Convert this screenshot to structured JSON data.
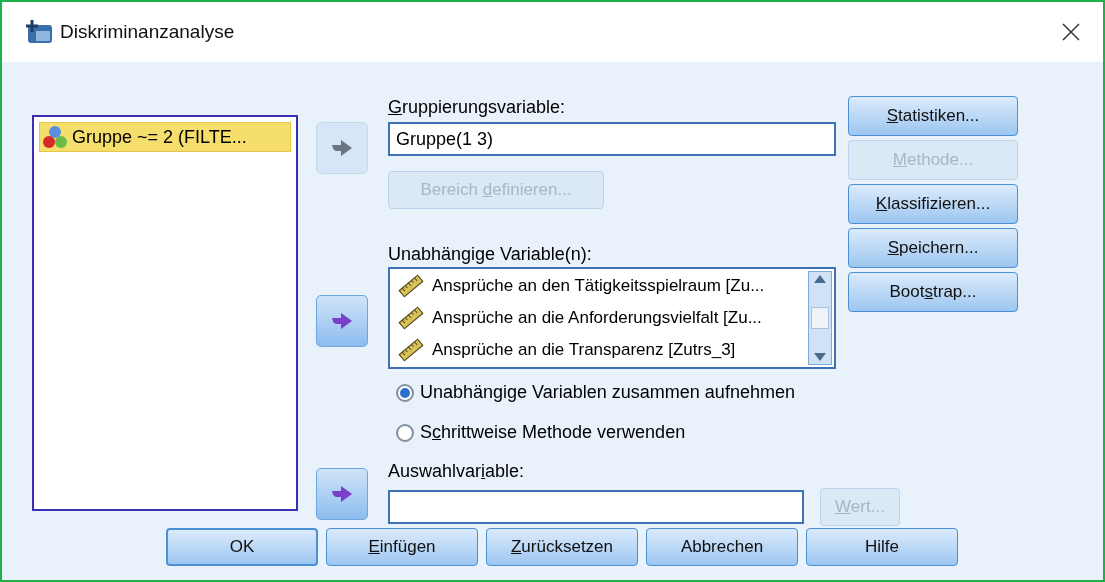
{
  "window": {
    "title": "Diskriminanzanalyse"
  },
  "source_list": [
    {
      "label": "Gruppe ~= 2 (FILTE...",
      "selected": true
    }
  ],
  "grouping": {
    "label": {
      "key": "G",
      "post": "ruppierungsvariable:"
    },
    "value": "Gruppe(1 3)",
    "define_button": {
      "label": {
        "pre": "Bereich ",
        "key": "d",
        "post": "efinieren..."
      },
      "disabled": true
    }
  },
  "independents": {
    "label": "Unabhängige Variable(n):",
    "items": [
      {
        "label": "Ansprüche an den Tätigkeitsspielraum [Zu..."
      },
      {
        "label": "Ansprüche an die Anforderungsvielfalt [Zu..."
      },
      {
        "label": "Ansprüche an die Transparenz [Zutrs_3]"
      }
    ]
  },
  "methods": [
    {
      "label": {
        "pre": "Unabhängi",
        "key": "g",
        "post": "e Variablen zusammen aufnehmen"
      },
      "selected": true
    },
    {
      "label": {
        "pre": "S",
        "key": "c",
        "post": "hrittweise Methode verwenden"
      },
      "selected": false
    }
  ],
  "selection": {
    "label": {
      "pre": "Auswahlvar",
      "key": "i",
      "post": "able:"
    },
    "value_button": {
      "label": {
        "key": "W",
        "post": "ert..."
      },
      "disabled": true
    }
  },
  "side_buttons": [
    {
      "label": {
        "key": "S",
        "post": "tatistiken..."
      },
      "disabled": false
    },
    {
      "label": {
        "key": "M",
        "post": "ethode..."
      },
      "disabled": true
    },
    {
      "label": {
        "key": "K",
        "post": "lassifizieren..."
      },
      "disabled": false
    },
    {
      "label": {
        "key": "S",
        "post": "peichern..."
      },
      "disabled": false
    },
    {
      "label": {
        "pre": "Boot",
        "key": "s",
        "post": "trap..."
      },
      "disabled": false
    }
  ],
  "bottom_buttons": [
    {
      "label": {
        "pre": "OK"
      },
      "default": true
    },
    {
      "label": {
        "key": "E",
        "post": "infügen"
      },
      "default": false
    },
    {
      "label": {
        "key": "Z",
        "post": "urücksetzen"
      },
      "default": false
    },
    {
      "label": {
        "pre": "Abbrechen"
      },
      "default": false
    },
    {
      "label": {
        "pre": "Hilfe"
      },
      "default": false
    }
  ]
}
